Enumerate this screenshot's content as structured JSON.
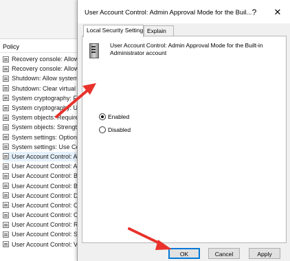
{
  "background": {
    "column_header": "Policy",
    "policies": [
      "Recovery console: Allow",
      "Recovery console: Allow",
      "Shutdown: Allow system",
      "Shutdown: Clear virtual r",
      "System cryptography: F",
      "System cryptography: Us",
      "System objects: Require c",
      "System objects: Strength",
      "System settings: Optiona",
      "System settings: Use Cer",
      "User Account Control: Ac",
      "User Account Control: Al",
      "User Account Control: Be",
      "User Account Control: Be",
      "User Account Control: De",
      "User Account Control: O",
      "User Account Control: O",
      "User Account Control: Ru",
      "User Account Control: Sw",
      "User Account Control: Vi"
    ],
    "selected_index": 10
  },
  "dialog": {
    "title": "User Account Control: Admin Approval Mode for the Buil...",
    "help_glyph": "?",
    "close_glyph": "✕",
    "tabs": [
      {
        "label": "Local Security Setting",
        "active": true
      },
      {
        "label": "Explain",
        "active": false
      }
    ],
    "policy_name": "User Account Control: Admin Approval Mode for the Built-in Administrator account",
    "options": {
      "enabled_label": "Enabled",
      "disabled_label": "Disabled",
      "selected": "Enabled"
    },
    "buttons": {
      "ok": "OK",
      "cancel": "Cancel",
      "apply": "Apply"
    }
  },
  "colors": {
    "annotation_arrow": "#e8322b",
    "dialog_bg": "#f0f0f0",
    "ok_focus_border": "#0078d7",
    "selected_row": "#e5f1fb"
  }
}
